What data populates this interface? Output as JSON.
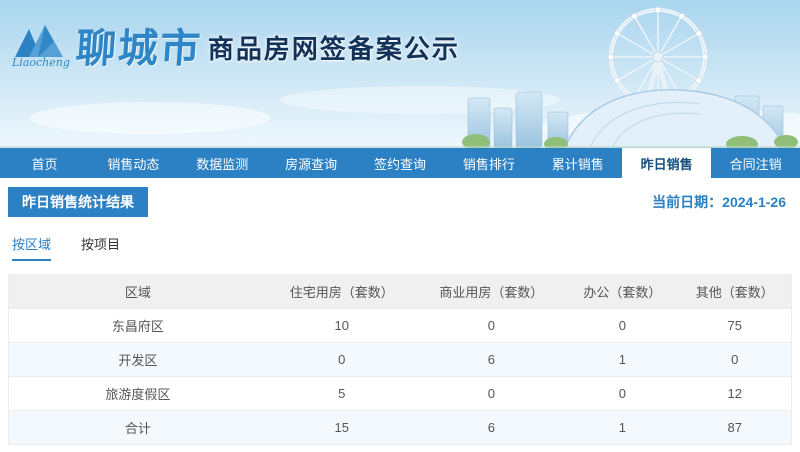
{
  "colors": {
    "accent_blue": "#2c80c4",
    "title_navy": "#13325a",
    "row_alt": "#f3f9fd"
  },
  "header": {
    "logo_script": "Liaocheng",
    "city_name": "聊城市",
    "site_title": "商品房网签备案公示"
  },
  "nav": {
    "items": [
      "首页",
      "销售动态",
      "数据监测",
      "房源查询",
      "签约查询",
      "销售排行",
      "累计销售",
      "昨日销售",
      "合同注销"
    ],
    "active": "昨日销售"
  },
  "section": {
    "title": "昨日销售统计结果",
    "current_date_label": "当前日期：2024-1-26"
  },
  "tabs": {
    "items": [
      "按区域",
      "按项目"
    ],
    "active": "按区域"
  },
  "table": {
    "headers": [
      "区域",
      "住宅用房（套数）",
      "商业用房（套数）",
      "办公（套数）",
      "其他（套数）"
    ],
    "rows": [
      {
        "region": "东昌府区",
        "residential": 10,
        "commercial": 0,
        "office": 0,
        "other": 75
      },
      {
        "region": "开发区",
        "residential": 0,
        "commercial": 6,
        "office": 1,
        "other": 0
      },
      {
        "region": "旅游度假区",
        "residential": 5,
        "commercial": 0,
        "office": 0,
        "other": 12
      },
      {
        "region": "合计",
        "residential": 15,
        "commercial": 6,
        "office": 1,
        "other": 87
      }
    ]
  }
}
